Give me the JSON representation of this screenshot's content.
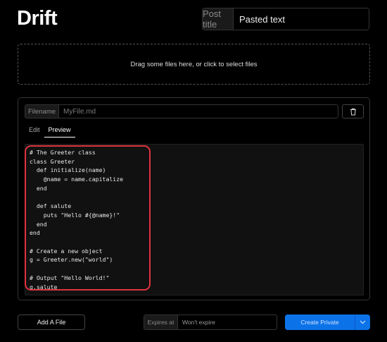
{
  "app": {
    "logo_text": "Drift"
  },
  "title": {
    "prefix": "Post title",
    "value": "Pasted text"
  },
  "dropzone": {
    "text": "Drag some files here, or click to select files"
  },
  "file": {
    "prefix": "Filename",
    "placeholder": "MyFile.md",
    "delete_icon": "trash-icon",
    "tabs": [
      {
        "label": "Edit",
        "active": false
      },
      {
        "label": "Preview",
        "active": true
      }
    ],
    "content": "# The Greeter class\nclass Greeter\n  def initialize(name)\n    @name = name.capitalize\n  end\n\n  def salute\n    puts \"Hello #{@name}!\"\n  end\nend\n\n# Create a new object\ng = Greeter.new(\"world\")\n\n# Output \"Hello World!\"\ng.salute"
  },
  "footer": {
    "add_file_label": "Add A File",
    "expires_prefix": "Expires at",
    "expires_value": "Won't expire",
    "create_label": "Create Private",
    "create_toggle_icon": "chevron-down-icon"
  },
  "colors": {
    "background": "#000000",
    "primary": "#0c72e8",
    "highlight": "#e0323e"
  }
}
